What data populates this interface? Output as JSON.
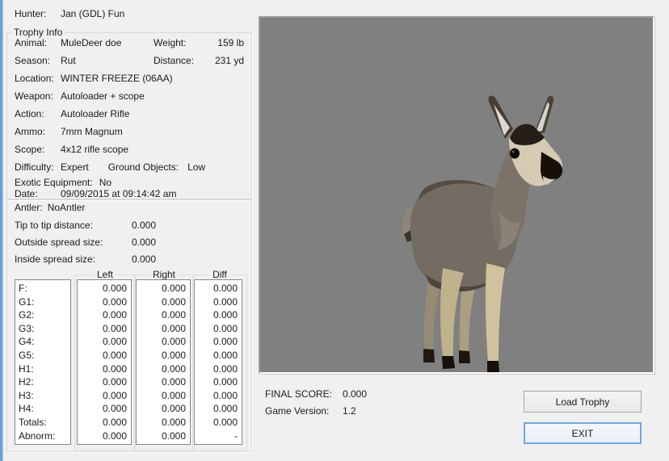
{
  "window": {
    "hunter_label": "Hunter:",
    "hunter_value": "Jan (GDL) Fun",
    "colors": {
      "background": "#f0f0f0",
      "accent_left_border": "#6b9fd2",
      "viewport_background": "#808080",
      "focused_button_border": "#6da8e0"
    }
  },
  "trophy_info": {
    "legend": "Trophy Info",
    "animal_label": "Animal:",
    "animal": "MuleDeer doe",
    "weight_label": "Weight:",
    "weight": "159 lb",
    "season_label": "Season:",
    "season": "Rut",
    "distance_label": "Distance:",
    "distance": "231 yd",
    "location_label": "Location:",
    "location": "WINTER FREEZE (06AA)",
    "weapon_label": "Weapon:",
    "weapon": "Autoloader + scope",
    "action_label": "Action:",
    "action": "Autoloader Rifle",
    "ammo_label": "Ammo:",
    "ammo": "7mm Magnum",
    "scope_label": "Scope:",
    "scope": "4x12 rifle scope",
    "difficulty_label": "Difficulty:",
    "difficulty": "Expert",
    "ground_objects_label": "Ground Objects:",
    "ground_objects": "Low",
    "exotic_label": "Exotic Equipment:",
    "exotic": "No",
    "date_label": "Date:",
    "date": "09/09/2015 at 09:14:42 am"
  },
  "antler_info": {
    "antler_label": "Antler:",
    "antler": "NoAntler",
    "tip_label": "Tip to tip distance:",
    "tip": "0.000",
    "outside_label": "Outside spread size:",
    "outside": "0.000",
    "inside_label": "Inside spread size:",
    "inside": "0.000"
  },
  "score_table": {
    "headers": {
      "left": "Left",
      "right": "Right",
      "diff": "Diff"
    },
    "row_labels": [
      "F:",
      "G1:",
      "G2:",
      "G3:",
      "G4:",
      "G5:",
      "H1:",
      "H2:",
      "H3:",
      "H4:",
      "Totals:",
      "Abnorm:"
    ],
    "left_values": [
      "0.000",
      "0.000",
      "0.000",
      "0.000",
      "0.000",
      "0.000",
      "0.000",
      "0.000",
      "0.000",
      "0.000",
      "0.000",
      "0.000"
    ],
    "right_values": [
      "0.000",
      "0.000",
      "0.000",
      "0.000",
      "0.000",
      "0.000",
      "0.000",
      "0.000",
      "0.000",
      "0.000",
      "0.000",
      "0.000"
    ],
    "diff_values": [
      "0.000",
      "0.000",
      "0.000",
      "0.000",
      "0.000",
      "0.000",
      "0.000",
      "0.000",
      "0.000",
      "0.000",
      "0.000",
      "-"
    ]
  },
  "footer": {
    "final_score_label": "FINAL SCORE:",
    "final_score": "0.000",
    "game_version_label": "Game Version:",
    "game_version": "1.2"
  },
  "buttons": {
    "load_trophy": "Load Trophy",
    "exit": "EXIT"
  },
  "viewport": {
    "description": "3D preview of MuleDeer doe trophy on gray background"
  }
}
